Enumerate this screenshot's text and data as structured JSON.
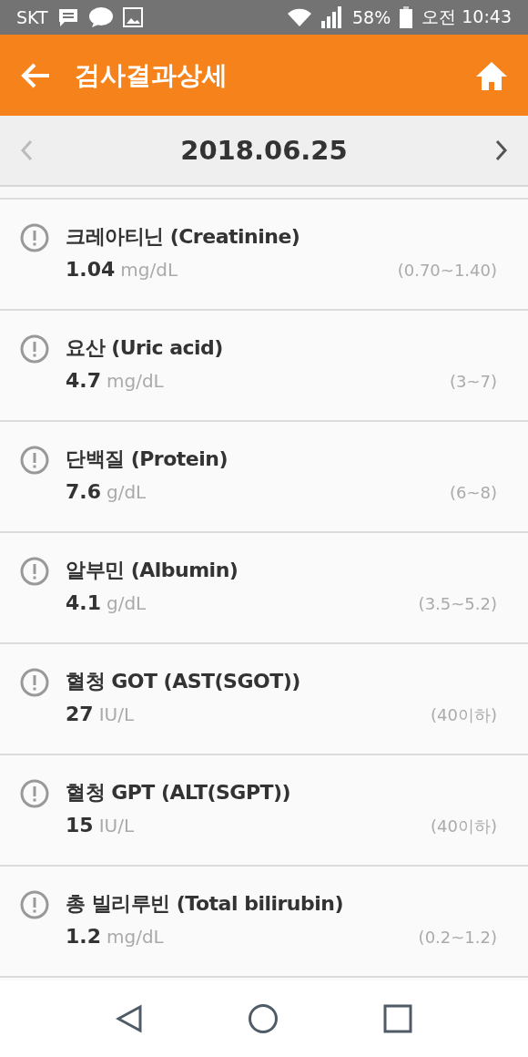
{
  "status_bar": {
    "carrier": "SKT",
    "battery": "58%",
    "time": "오전 10:43"
  },
  "header": {
    "title": "검사결과상세"
  },
  "date_nav": {
    "date": "2018.06.25",
    "prev_disabled": true,
    "next_disabled": false
  },
  "results": [
    {
      "name": "크레아티닌 (Creatinine)",
      "value": "1.04",
      "unit": "mg/dL",
      "range": "(0.70~1.40)"
    },
    {
      "name": "요산 (Uric acid)",
      "value": "4.7",
      "unit": "mg/dL",
      "range": "(3~7)"
    },
    {
      "name": "단백질 (Protein)",
      "value": "7.6",
      "unit": "g/dL",
      "range": "(6~8)"
    },
    {
      "name": "알부민 (Albumin)",
      "value": "4.1",
      "unit": "g/dL",
      "range": "(3.5~5.2)"
    },
    {
      "name": "혈청 GOT (AST(SGOT))",
      "value": "27",
      "unit": "IU/L",
      "range": "(40이하)"
    },
    {
      "name": "혈청 GPT (ALT(SGPT))",
      "value": "15",
      "unit": "IU/L",
      "range": "(40이하)"
    },
    {
      "name": "총 빌리루빈 (Total bilirubin)",
      "value": "1.2",
      "unit": "mg/dL",
      "range": "(0.2~1.2)"
    }
  ]
}
